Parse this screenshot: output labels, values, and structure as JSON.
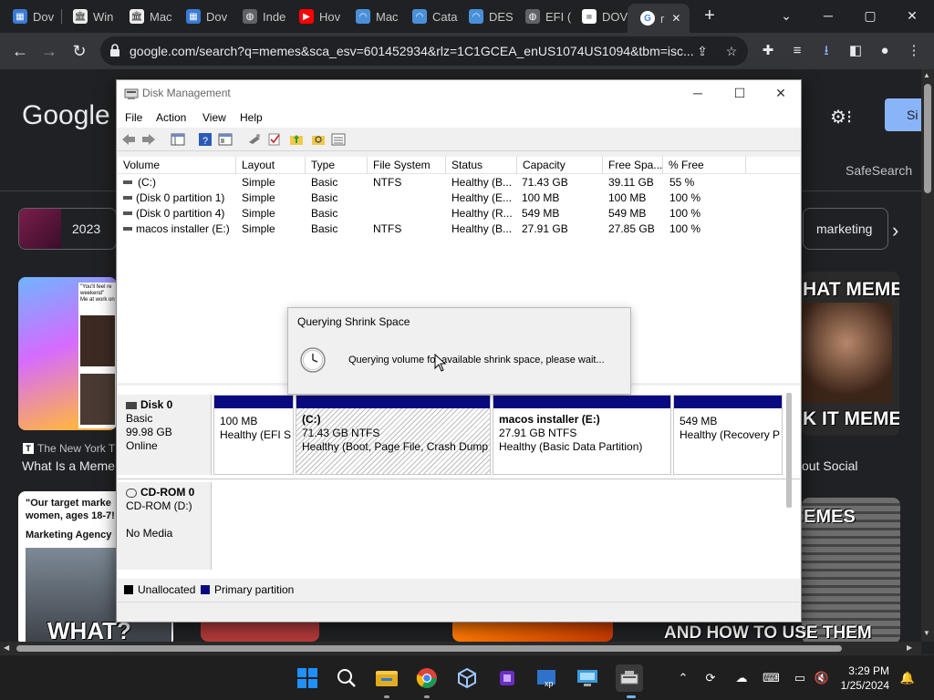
{
  "browser": {
    "tabs": [
      {
        "label": "Dov",
        "icon": "app-icon",
        "color": "#3a7bd5"
      },
      {
        "label": "Win",
        "icon": "bank-icon",
        "color": "#cccccc"
      },
      {
        "label": "Mac",
        "icon": "bank-icon",
        "color": "#cccccc"
      },
      {
        "label": "Dov",
        "icon": "app-icon",
        "color": "#3a7bd5"
      },
      {
        "label": "Inde",
        "icon": "globe-icon",
        "color": "#9aa0a6"
      },
      {
        "label": "Hov",
        "icon": "youtube-icon",
        "color": "#ff0000"
      },
      {
        "label": "Mac",
        "icon": "swirl-icon",
        "color": "#4a90d9"
      },
      {
        "label": "Cata",
        "icon": "swirl-icon",
        "color": "#4a90d9"
      },
      {
        "label": "DES",
        "icon": "swirl-icon",
        "color": "#4a90d9"
      },
      {
        "label": "EFI (",
        "icon": "globe-icon",
        "color": "#9aa0a6"
      },
      {
        "label": "DOV",
        "icon": "doc-icon",
        "color": "#ffffff"
      },
      {
        "label": "r",
        "icon": "google-icon",
        "color": "#4285f4"
      }
    ],
    "active_tab_close": "✕",
    "new_tab": "+",
    "window_controls": {
      "min": "─",
      "max": "▢",
      "close": "✕",
      "dropdown": "⌄"
    },
    "url": "google.com/search?q=memes&sca_esv=601452934&rlz=1C1GCEA_enUS1074US1094&tbm=isc..."
  },
  "google": {
    "logo": "Google",
    "signin_partial": "Si",
    "safesearch": "SafeSearch",
    "chips": {
      "c2023": "2023",
      "marketing": "marketing"
    },
    "tiles": {
      "t1_source": "The New York T",
      "t1_title": "What Is a Meme",
      "t1_quote1": "\"You'll feel re",
      "t1_quote2": "weekend\"",
      "t1_quote3": "Me at work on",
      "t2_title": "out Social",
      "t2_text_top": "HAT MEMES",
      "t2_text_bottom": "K IT MEMES",
      "t3_quote1": "\"Our target marke",
      "t3_quote2": "women, ages 18-7!",
      "t3_quote3": "Marketing Agency",
      "t3_caption": "WHAT?",
      "t4_text": "EMES",
      "t5_caption": "AND HOW TO USE THEM"
    }
  },
  "disk_management": {
    "title": "Disk Management",
    "menu": [
      "File",
      "Action",
      "View",
      "Help"
    ],
    "columns": [
      "Volume",
      "Layout",
      "Type",
      "File System",
      "Status",
      "Capacity",
      "Free Spa...",
      "% Free"
    ],
    "volumes": [
      {
        "volume": "(C:)",
        "layout": "Simple",
        "type": "Basic",
        "fs": "NTFS",
        "status": "Healthy (B...",
        "capacity": "71.43 GB",
        "free": "39.11 GB",
        "pct": "55 %"
      },
      {
        "volume": "(Disk 0 partition 1)",
        "layout": "Simple",
        "type": "Basic",
        "fs": "",
        "status": "Healthy (E...",
        "capacity": "100 MB",
        "free": "100 MB",
        "pct": "100 %"
      },
      {
        "volume": "(Disk 0 partition 4)",
        "layout": "Simple",
        "type": "Basic",
        "fs": "",
        "status": "Healthy (R...",
        "capacity": "549 MB",
        "free": "549 MB",
        "pct": "100 %"
      },
      {
        "volume": "macos installer (E:)",
        "layout": "Simple",
        "type": "Basic",
        "fs": "NTFS",
        "status": "Healthy (B...",
        "capacity": "27.91 GB",
        "free": "27.85 GB",
        "pct": "100 %"
      }
    ],
    "disk0": {
      "name": "Disk 0",
      "type": "Basic",
      "size": "99.98 GB",
      "state": "Online"
    },
    "partitions": [
      {
        "name": "",
        "size": "100 MB",
        "status": "Healthy (EFI S"
      },
      {
        "name": "(C:)",
        "size": "71.43 GB NTFS",
        "status": "Healthy (Boot, Page File, Crash Dump,"
      },
      {
        "name": "macos installer  (E:)",
        "size": "27.91 GB NTFS",
        "status": "Healthy (Basic Data Partition)"
      },
      {
        "name": "",
        "size": "549 MB",
        "status": "Healthy (Recovery P"
      }
    ],
    "cdrom": {
      "name": "CD-ROM 0",
      "device": "CD-ROM (D:)",
      "media": "No Media"
    },
    "legend": {
      "unallocated": "Unallocated",
      "primary": "Primary partition",
      "unallocated_color": "#000000",
      "primary_color": "#0a0a80"
    },
    "dialog": {
      "title": "Querying Shrink Space",
      "message": "Querying volume for available shrink space, please wait..."
    }
  },
  "taskbar": {
    "time": "3:29 PM",
    "date": "1/25/2024"
  }
}
